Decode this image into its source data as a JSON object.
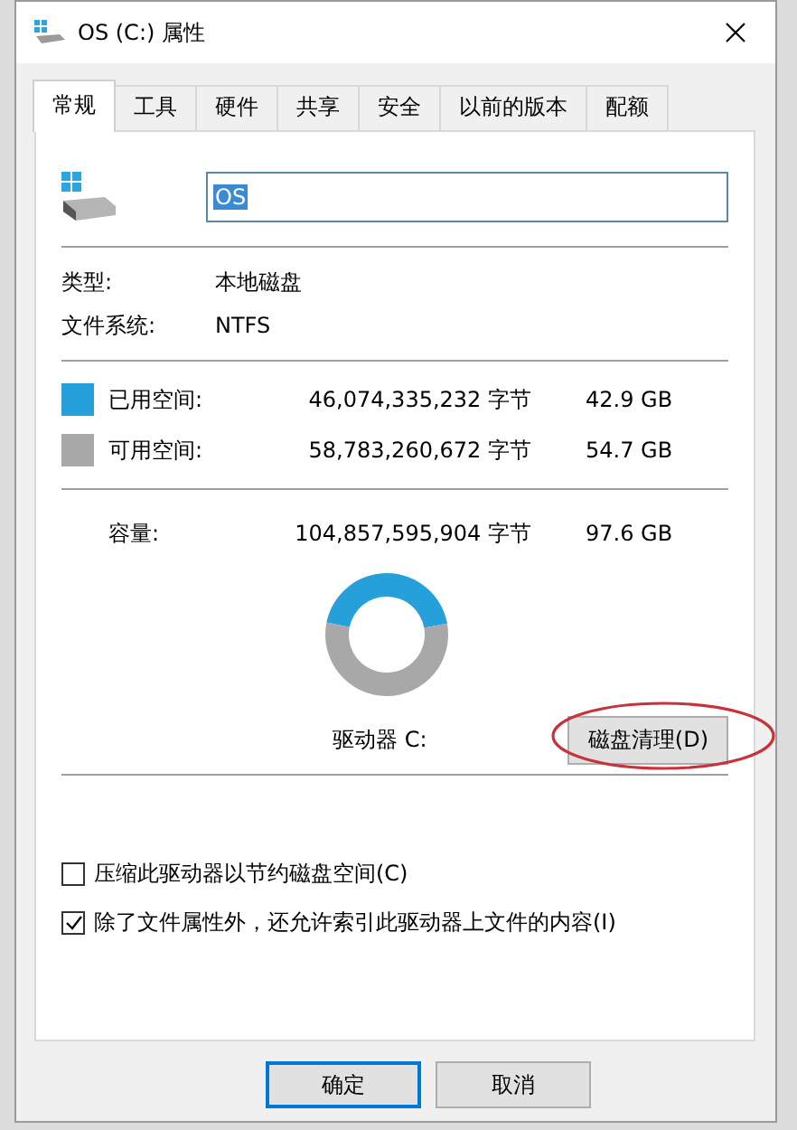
{
  "window": {
    "title": "OS (C:) 属性"
  },
  "tabs": [
    {
      "label": "常规",
      "selected": true
    },
    {
      "label": "工具",
      "selected": false
    },
    {
      "label": "硬件",
      "selected": false
    },
    {
      "label": "共享",
      "selected": false
    },
    {
      "label": "安全",
      "selected": false
    },
    {
      "label": "以前的版本",
      "selected": false
    },
    {
      "label": "配额",
      "selected": false
    }
  ],
  "name_field": {
    "value": "OS"
  },
  "properties": [
    {
      "label": "类型:",
      "value": "本地磁盘"
    },
    {
      "label": "文件系统:",
      "value": "NTFS"
    }
  ],
  "space": [
    {
      "label": "已用空间:",
      "bytes": "46,074,335,232 字节",
      "size": "42.9 GB",
      "color": "#26a0da"
    },
    {
      "label": "可用空间:",
      "bytes": "58,783,260,672 字节",
      "size": "54.7 GB",
      "color": "#a8a8a8"
    }
  ],
  "capacity": {
    "label": "容量:",
    "bytes": "104,857,595,904 字节",
    "size": "97.6 GB"
  },
  "drive_label": "驱动器 C:",
  "cleanup_button": {
    "label": "磁盘清理(D)",
    "circled": true
  },
  "options": [
    {
      "label": "压缩此驱动器以节约磁盘空间(C)",
      "checked": false
    },
    {
      "label": "除了文件属性外，还允许索引此驱动器上文件的内容(I)",
      "checked": true
    }
  ],
  "buttons": [
    "确定",
    "取消"
  ]
}
